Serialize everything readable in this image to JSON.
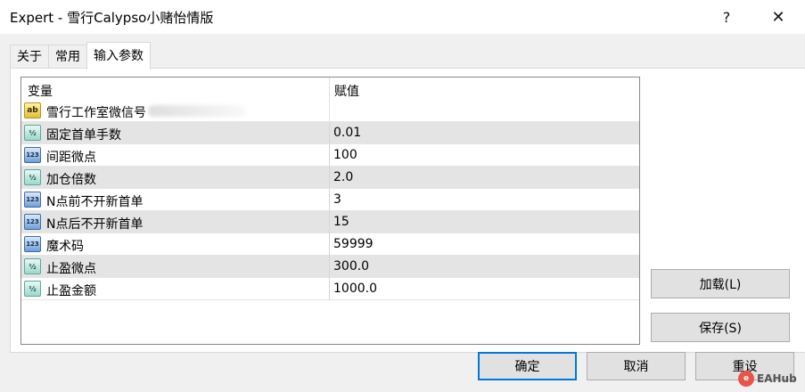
{
  "window": {
    "title": "Expert - 雪行Calypso小赌怡情版",
    "help_label": "?",
    "close_label": "✕"
  },
  "tabs": [
    {
      "label": "关于",
      "active": false
    },
    {
      "label": "常用",
      "active": false
    },
    {
      "label": "输入参数",
      "active": true
    }
  ],
  "grid": {
    "columns": {
      "variable": "变量",
      "value": "赋值"
    },
    "rows": [
      {
        "icon": "string-icon",
        "name": "雪行工作室微信号",
        "value": ""
      },
      {
        "icon": "double-icon",
        "name": "固定首单手数",
        "value": "0.01"
      },
      {
        "icon": "integer-icon",
        "name": "间距微点",
        "value": "100"
      },
      {
        "icon": "double-icon",
        "name": "加仓倍数",
        "value": "2.0"
      },
      {
        "icon": "integer-icon",
        "name": "N点前不开新首单",
        "value": "3"
      },
      {
        "icon": "integer-icon",
        "name": "N点后不开新首单",
        "value": "15"
      },
      {
        "icon": "integer-icon",
        "name": "魔术码",
        "value": "59999"
      },
      {
        "icon": "double-icon",
        "name": "止盈微点",
        "value": "300.0"
      },
      {
        "icon": "double-icon",
        "name": "止盈金额",
        "value": "1000.0"
      }
    ]
  },
  "buttons": {
    "load": "加载(L)",
    "save": "保存(S)",
    "ok": "确定",
    "cancel": "取消",
    "reset": "重设"
  },
  "icon_glyphs": {
    "string": "ab",
    "double": "½",
    "integer": "123"
  },
  "watermark": {
    "text": "EAHub",
    "icon": "e"
  },
  "colors": {
    "accent": "#0078d7",
    "row_alt": "#e4e4e4"
  }
}
